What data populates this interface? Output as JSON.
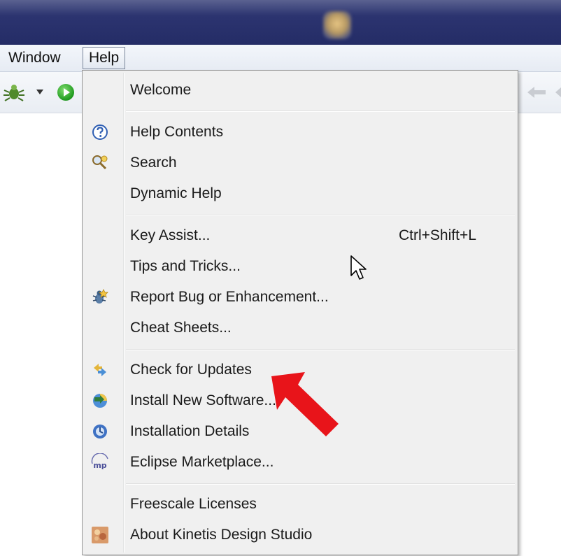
{
  "menubar": {
    "window_label": "Window",
    "help_label": "Help"
  },
  "help_menu": {
    "items": [
      {
        "label": "Welcome",
        "icon": "none"
      },
      {
        "label": "Help Contents",
        "icon": "help-contents-icon"
      },
      {
        "label": "Search",
        "icon": "search-icon"
      },
      {
        "label": "Dynamic Help",
        "icon": "none"
      },
      {
        "label": "Key Assist...",
        "accelerator": "Ctrl+Shift+L",
        "icon": "none"
      },
      {
        "label": "Tips and Tricks...",
        "icon": "none"
      },
      {
        "label": "Report Bug or Enhancement...",
        "icon": "report-bug-icon"
      },
      {
        "label": "Cheat Sheets...",
        "icon": "none"
      },
      {
        "label": "Check for Updates",
        "icon": "check-updates-icon"
      },
      {
        "label": "Install New Software...",
        "icon": "install-software-icon"
      },
      {
        "label": "Installation Details",
        "icon": "installation-details-icon"
      },
      {
        "label": "Eclipse Marketplace...",
        "icon": "marketplace-icon",
        "icon_text": "mp"
      },
      {
        "label": "Freescale Licenses",
        "icon": "none"
      },
      {
        "label": "About Kinetis Design Studio",
        "icon": "kinetis-logo-icon"
      }
    ]
  },
  "colors": {
    "titlebar": "#242c66",
    "menu_background": "#f0f0f0",
    "highlight_arrow": "#e8141a"
  }
}
